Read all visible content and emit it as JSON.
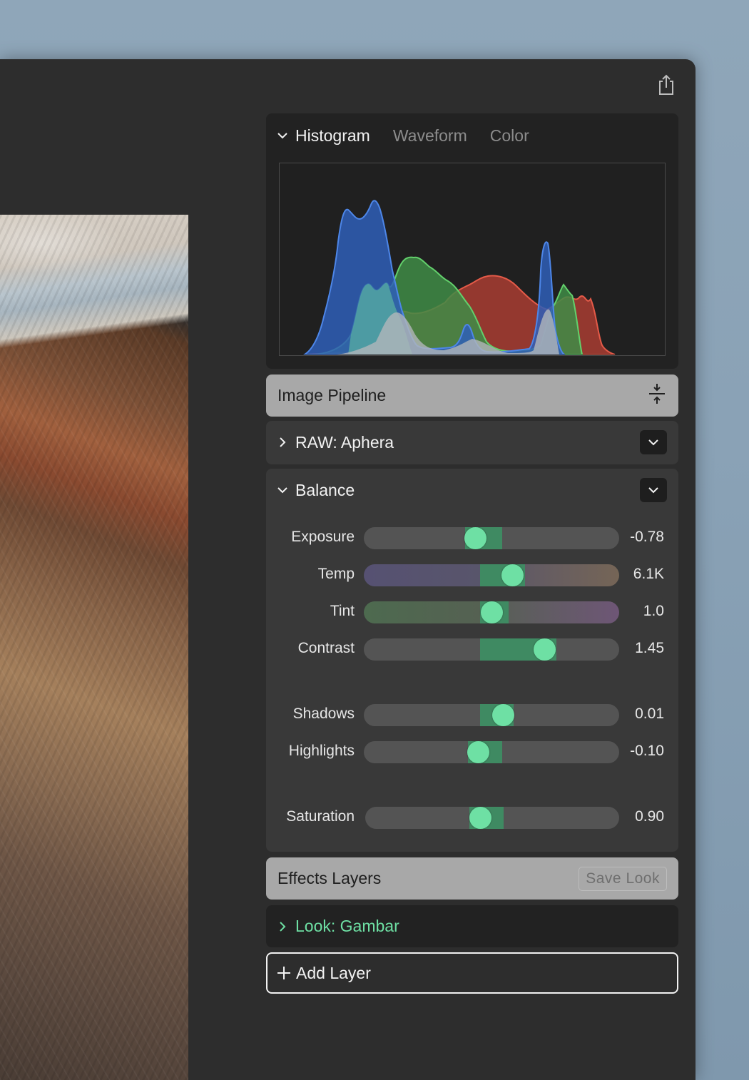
{
  "histogram": {
    "tabs": [
      {
        "label": "Histogram",
        "active": true
      },
      {
        "label": "Waveform",
        "active": false
      },
      {
        "label": "Color",
        "active": false
      }
    ]
  },
  "pipeline": {
    "title": "Image Pipeline",
    "icon": "collapse-icon"
  },
  "raw": {
    "label": "RAW: Aphera",
    "icon": "chevron-right-icon"
  },
  "balance": {
    "label": "Balance",
    "sliders": [
      {
        "label": "Exposure",
        "value": "-0.78"
      },
      {
        "label": "Temp",
        "value": "6.1K"
      },
      {
        "label": "Tint",
        "value": "1.0"
      },
      {
        "label": "Contrast",
        "value": "1.45"
      },
      {
        "label": "Shadows",
        "value": "0.01"
      },
      {
        "label": "Highlights",
        "value": "-0.10"
      },
      {
        "label": "Saturation",
        "value": "0.90"
      }
    ]
  },
  "effects": {
    "title": "Effects Layers",
    "save_label": "Save Look"
  },
  "look": {
    "label": "Look: Gambar"
  },
  "add_layer": {
    "label": "Add Layer"
  },
  "colors": {
    "accent": "#6ee0a4",
    "fill": "#3f8a62",
    "panel": "#393939",
    "window": "#2d2d2d"
  }
}
